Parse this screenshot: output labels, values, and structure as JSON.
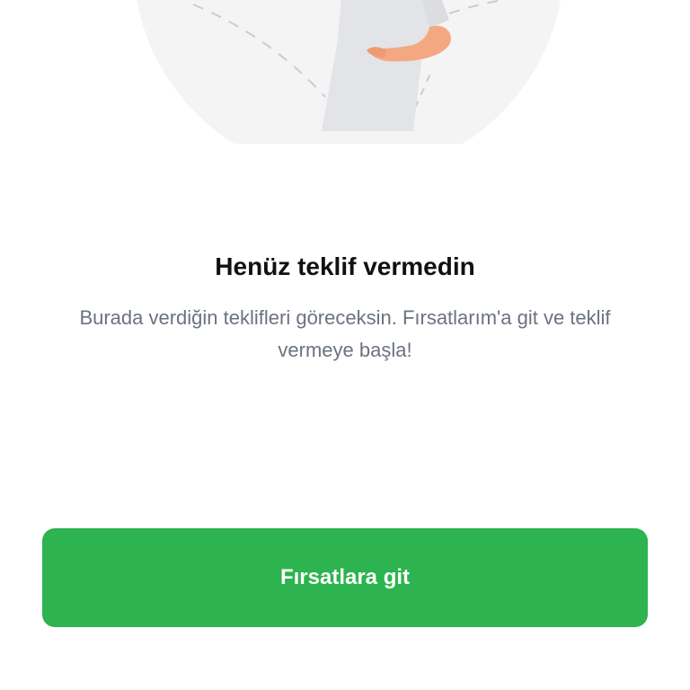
{
  "empty_state": {
    "illustration_icon": "person-pointing-illustration",
    "title": "Henüz teklif vermedin",
    "description": "Burada verdiğin teklifleri göreceksin. Fırsatlarım'a git ve teklif vermeye başla!"
  },
  "cta": {
    "label": "Fırsatlara git",
    "color": "#2DB34F"
  }
}
